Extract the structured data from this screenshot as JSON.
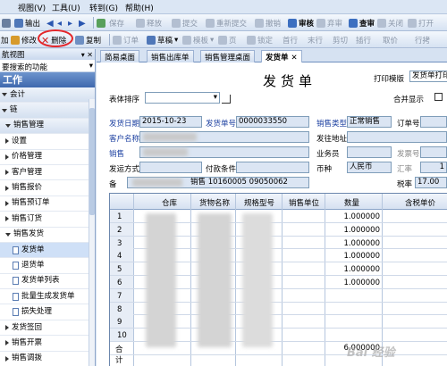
{
  "menu": [
    {
      "label": "视图(V)"
    },
    {
      "label": "工具(U)"
    },
    {
      "label": "转到(G)"
    },
    {
      "label": "帮助(H)"
    }
  ],
  "toolbar1": {
    "export": "输出",
    "save_draft": "保存",
    "release": "释放",
    "submit": "提交",
    "resubmit": "重新提交",
    "cancel": "撤销",
    "audit": "审核",
    "abandon": "弃审",
    "check": "查审",
    "close": "关闭",
    "open": "打开",
    "open2": "开"
  },
  "toolbar2": {
    "add": "加",
    "modify": "修改",
    "delete": "删除",
    "copy": "复制",
    "order": "订单",
    "draft": "草稿",
    "template": "模板",
    "page": "页",
    "lock": "锁定",
    "first": "首行",
    "last": "末行",
    "cut": "剪切",
    "paste_row": "插行",
    "take": "取价",
    "row_copy": "行拷"
  },
  "nav": {
    "title": "航视图",
    "search_text": "要搜索的功能",
    "work": "工作",
    "items": [
      {
        "label": "会计",
        "level": "group"
      },
      {
        "label": "链",
        "level": "group"
      },
      {
        "label": "销售管理",
        "level": "sub"
      },
      {
        "label": "设置",
        "level": "leaf-group"
      },
      {
        "label": "价格管理",
        "level": "leaf-group"
      },
      {
        "label": "客户管理",
        "level": "leaf-group"
      },
      {
        "label": "销售报价",
        "level": "leaf-group"
      },
      {
        "label": "销售预订单",
        "level": "leaf-group"
      },
      {
        "label": "销售订货",
        "level": "leaf-group"
      },
      {
        "label": "销售发货",
        "level": "leaf-group"
      },
      {
        "label": "发货单",
        "level": "leaf"
      },
      {
        "label": "退货单",
        "level": "leaf"
      },
      {
        "label": "发货单列表",
        "level": "leaf"
      },
      {
        "label": "批量生成发货单",
        "level": "leaf"
      },
      {
        "label": "损失处理",
        "level": "leaf"
      },
      {
        "label": "发货签回",
        "level": "leaf-group"
      },
      {
        "label": "销售开票",
        "level": "leaf-group"
      },
      {
        "label": "销售调拨",
        "level": "leaf-group"
      },
      {
        "label": "零售日报",
        "level": "leaf-group"
      }
    ]
  },
  "tabs": [
    {
      "label": "简易桌面"
    },
    {
      "label": "销售出库单"
    },
    {
      "label": "销售管理桌面"
    },
    {
      "label": "发货单"
    }
  ],
  "form": {
    "title": "发货单",
    "print_template_label": "打印模版",
    "print_template_value": "发货单打印",
    "sort_label": "表体排序",
    "merge_label": "合并显示",
    "ship_date_label": "发货日期",
    "ship_date": "2015-10-23",
    "ship_no_label": "发货单号",
    "ship_no": "0000033550",
    "sale_type_label": "销售类型",
    "sale_type": "正常销售",
    "order_no_label": "订单号",
    "customer_label": "客户名称",
    "ship_addr_label": "发往地址",
    "dept_label": "销售",
    "salesman_label": "业务员",
    "invoice_no_label": "发票号",
    "transport_label": "发运方式",
    "payment_label": "付款条件",
    "currency_label": "币种",
    "currency": "人民币",
    "rate_label": "汇率",
    "rate": "1",
    "remark_label": "备",
    "remark_value": "销售 10160005 09050062",
    "tax_label": "税率",
    "tax": "17.00"
  },
  "grid": {
    "headers": [
      "仓库",
      "货物名称",
      "规格型号",
      "销售单位",
      "数量",
      "含税单价"
    ],
    "rows": [
      {
        "n": "1",
        "qty": "1.000000"
      },
      {
        "n": "2",
        "qty": "1.000000"
      },
      {
        "n": "3",
        "qty": "1.000000"
      },
      {
        "n": "4",
        "qty": "1.000000"
      },
      {
        "n": "5",
        "qty": "1.000000"
      },
      {
        "n": "6",
        "qty": "1.000000"
      },
      {
        "n": "7",
        "qty": ""
      },
      {
        "n": "8",
        "qty": ""
      },
      {
        "n": "9",
        "qty": ""
      },
      {
        "n": "10",
        "qty": ""
      }
    ],
    "total_label": "合计",
    "total_qty": "6.000000"
  },
  "watermark": "Bai 经验"
}
